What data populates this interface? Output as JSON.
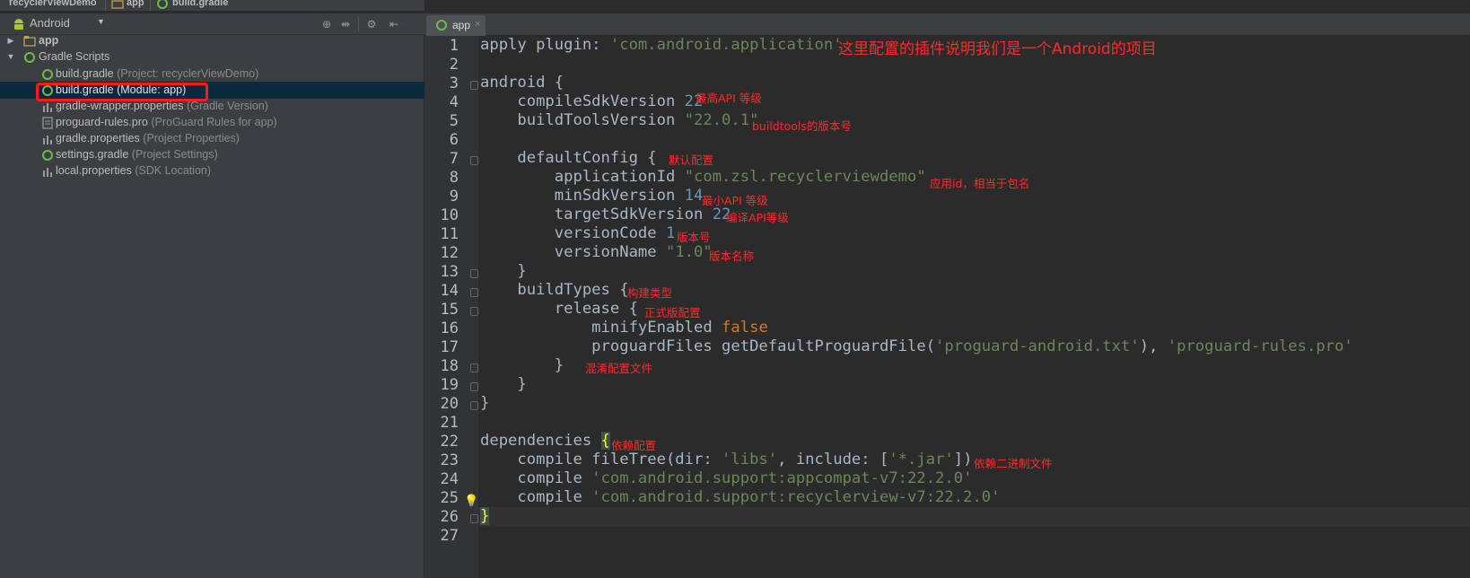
{
  "breadcrumb": {
    "items": [
      "recyclerViewDemo",
      "app",
      "build.gradle"
    ]
  },
  "project_panel": {
    "view_mode": "Android",
    "tree": [
      {
        "label": "app",
        "sub": "",
        "icon": "folder-icon",
        "expanded": false,
        "bold": true
      },
      {
        "label": "Gradle Scripts",
        "sub": "",
        "icon": "gradle-icon",
        "expanded": true,
        "bold": false
      },
      {
        "label": "build.gradle",
        "sub": "(Project: recyclerViewDemo)",
        "icon": "gradle-icon"
      },
      {
        "label": "build.gradle (Module: app)",
        "sub": "",
        "icon": "gradle-icon",
        "selected": true
      },
      {
        "label": "gradle-wrapper.properties",
        "sub": "(Gradle Version)",
        "icon": "properties-icon"
      },
      {
        "label": "proguard-rules.pro",
        "sub": "(ProGuard Rules for app)",
        "icon": "file-icon"
      },
      {
        "label": "gradle.properties",
        "sub": "(Project Properties)",
        "icon": "properties-icon"
      },
      {
        "label": "settings.gradle",
        "sub": "(Project Settings)",
        "icon": "gradle-icon"
      },
      {
        "label": "local.properties",
        "sub": "(SDK Location)",
        "icon": "properties-icon"
      }
    ]
  },
  "editor": {
    "tab": {
      "label": "app",
      "close": "×"
    },
    "line_numbers": [
      "1",
      "2",
      "3",
      "4",
      "5",
      "6",
      "7",
      "8",
      "9",
      "10",
      "11",
      "12",
      "13",
      "14",
      "15",
      "16",
      "17",
      "18",
      "19",
      "20",
      "21",
      "22",
      "23",
      "24",
      "25",
      "26",
      "27"
    ],
    "code": {
      "l1_kw": "apply plugin:",
      "l1_str": " 'com.android.application'",
      "l3": "android {",
      "l4_kw": "    compileSdkVersion ",
      "l4_num": "22",
      "l5_kw": "    buildToolsVersion ",
      "l5_str": "\"22.0.1\"",
      "l7": "    defaultConfig {",
      "l8_kw": "        applicationId ",
      "l8_str": "\"com.zsl.recyclerviewdemo\"",
      "l9_kw": "        minSdkVersion ",
      "l9_num": "14",
      "l10_kw": "        targetSdkVersion ",
      "l10_num": "22",
      "l11_kw": "        versionCode ",
      "l11_num": "1",
      "l12_kw": "        versionName ",
      "l12_str": "\"1.0\"",
      "l13": "    }",
      "l14": "    buildTypes {",
      "l15": "        release {",
      "l16_kw": "            minifyEnabled ",
      "l16_val": "false",
      "l17_a": "            proguardFiles getDefaultProguardFile(",
      "l17_s1": "'proguard-android.txt'",
      "l17_b": "), ",
      "l17_s2": "'proguard-rules.pro'",
      "l18": "        }",
      "l19": "    }",
      "l20": "}",
      "l22_a": "dependencies ",
      "l22_b": "{",
      "l23_a": "    compile fileTree(dir: ",
      "l23_s1": "'libs'",
      "l23_b": ", include: [",
      "l23_s2": "'*.jar'",
      "l23_c": "])",
      "l24_a": "    compile ",
      "l24_s": "'com.android.support:appcompat-v7:22.2.0'",
      "l25_a": "    compile ",
      "l25_s": "'com.android.support:recyclerview-v7:22.2.0'",
      "l26": "}"
    },
    "notes": {
      "n1": "这里配置的插件说明我们是一个Android的项目",
      "n4": "最高API 等级",
      "n5": "buildtools的版本号",
      "n7": "默认配置",
      "n8": "应用id，相当于包名",
      "n9": "最小API 等级",
      "n10": "编译API等级",
      "n11": "版本号",
      "n12": "版本名称",
      "n14": "构建类型",
      "n15": "正式版配置",
      "n18": "混淆配置文件",
      "n22": "依赖配置",
      "n23": "依赖二进制文件"
    }
  }
}
